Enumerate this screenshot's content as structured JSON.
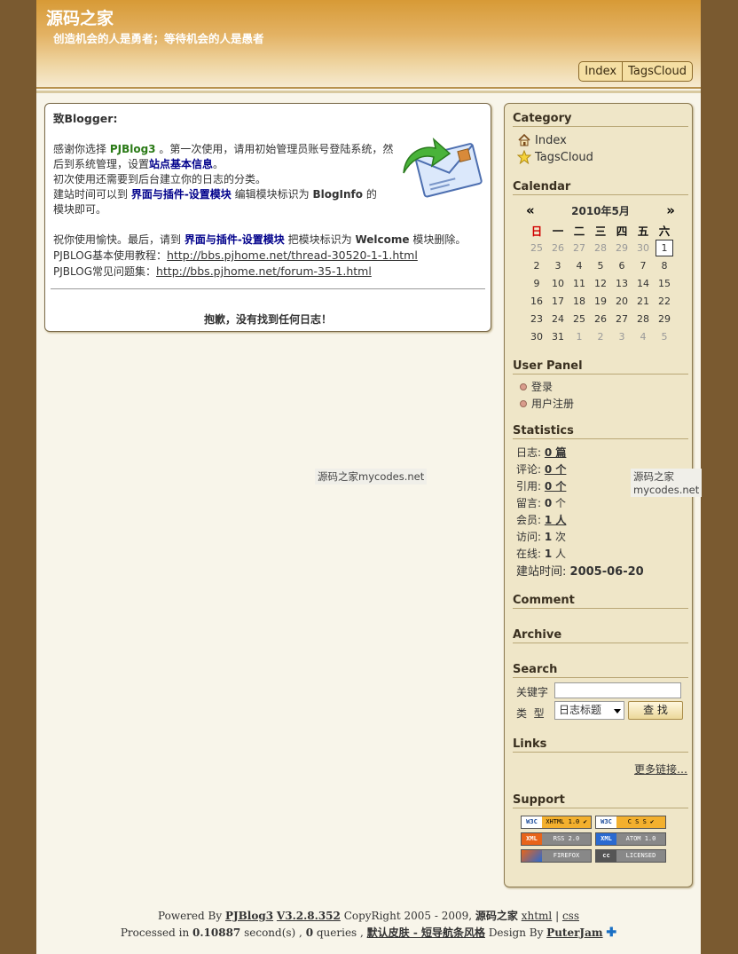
{
  "header": {
    "site_title": "源码之家",
    "subtitle": "创造机会的人是勇者；等待机会的人是愚者",
    "nav": [
      "Index",
      "TagsCloud"
    ]
  },
  "main": {
    "greeting": "致Blogger:",
    "line1_a": "感谢你选择 ",
    "line1_brand": "PJBlog3",
    "line1_b": " 。第一次使用，请用初始管理员账号登陆系统，然",
    "line2_a": "后到系统管理，设置",
    "line2_link": "站点基本信息",
    "line2_b": "。",
    "line3": "初次使用还需要到后台建立你的日志的分类。",
    "line4_a": "建站时间可以到 ",
    "line4_link": "界面与插件-设置模块",
    "line4_b": " 编辑模块标识为 ",
    "line4_key": "BlogInfo",
    "line4_c": " 的",
    "line5": "模块即可。",
    "line6_a": "祝你使用愉快。最后，请到 ",
    "line6_link": "界面与插件-设置模块",
    "line6_b": " 把模块标识为 ",
    "line6_key": "Welcome",
    "line6_c": " 模块删除。",
    "tut_label": "PJBLOG基本使用教程：",
    "tut_url": "http://bbs.pjhome.net/thread-30520-1-1.html",
    "faq_label": "PJBLOG常见问题集：",
    "faq_url": "http://bbs.pjhome.net/forum-35-1.html",
    "not_found": "抱歉，没有找到任何日志！"
  },
  "watermark": "源码之家mycodes.net",
  "sidebar": {
    "category_title": "Category",
    "categories": [
      "Index",
      "TagsCloud"
    ],
    "calendar_title": "Calendar",
    "calendar": {
      "prev": "«",
      "month": "2010年5月",
      "next": "»",
      "weekdays": [
        "日",
        "一",
        "二",
        "三",
        "四",
        "五",
        "六"
      ],
      "weeks": [
        [
          "25",
          "26",
          "27",
          "28",
          "29",
          "30",
          "1"
        ],
        [
          "2",
          "3",
          "4",
          "5",
          "6",
          "7",
          "8"
        ],
        [
          "9",
          "10",
          "11",
          "12",
          "13",
          "14",
          "15"
        ],
        [
          "16",
          "17",
          "18",
          "19",
          "20",
          "21",
          "22"
        ],
        [
          "23",
          "24",
          "25",
          "26",
          "27",
          "28",
          "29"
        ],
        [
          "30",
          "31",
          "1",
          "2",
          "3",
          "4",
          "5"
        ]
      ]
    },
    "userpanel_title": "User Panel",
    "userpanel": [
      "登录",
      "用户注册"
    ],
    "stats_title": "Statistics",
    "stats": {
      "log_label": "日志:",
      "log_val": "0 篇",
      "comment_label": "评论:",
      "comment_val": "0 个",
      "ref_label": "引用:",
      "ref_val": "0 个",
      "msg_label": "留言:",
      "msg_val": "0",
      "msg_unit": " 个",
      "member_label": "会员:",
      "member_val": "1 人",
      "visit_label": "访问:",
      "visit_val": "1",
      "visit_unit": " 次",
      "online_label": "在线:",
      "online_val": "1",
      "online_unit": " 人",
      "since_label": "建站时间:",
      "since_val": "2005-06-20"
    },
    "comment_title": "Comment",
    "archive_title": "Archive",
    "search_title": "Search",
    "search": {
      "kw_label": "关键字",
      "type_label": "类  型",
      "type_value": "日志标题",
      "button": "查 找"
    },
    "links_title": "Links",
    "more_links": "更多链接…",
    "support_title": "Support",
    "badges": [
      {
        "l": "W3C",
        "r": "XHTML 1.0 ✔"
      },
      {
        "l": "W3C",
        "r": "C S S ✔"
      },
      {
        "l": "XML",
        "r": "RSS 2.0"
      },
      {
        "l": "XML",
        "r": "ATOM 1.0"
      },
      {
        "l": "",
        "r": "FIREFOX"
      },
      {
        "l": "cc",
        "r": "LICENSED"
      }
    ]
  },
  "footer": {
    "powered": "Powered By ",
    "brand": "PJBlog3",
    "version": "V3.2.8.352",
    "copyright": " CopyRight 2005 - 2009, ",
    "site": "源码之家",
    "xhtml": "xhtml",
    "sep": " | ",
    "css": "css",
    "processed": "Processed in ",
    "seconds": "0.10887",
    "sec_label": " second(s) , ",
    "queries": "0",
    "q_label": " queries , ",
    "skin": "默认皮肤 - 短导航条风格",
    "design_by": " Design By ",
    "designer": "PuterJam"
  }
}
